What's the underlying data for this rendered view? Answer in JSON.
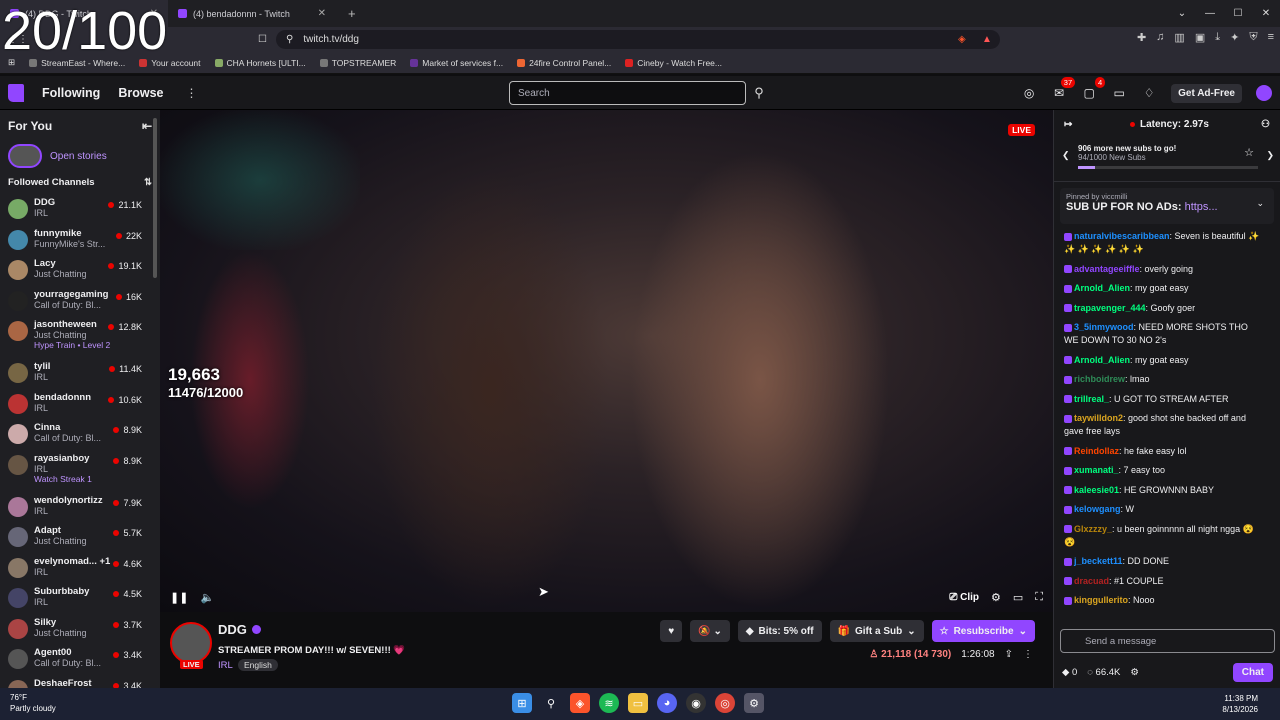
{
  "overlay_counter": "20/100",
  "browser": {
    "tabs": [
      {
        "title": "(4) DDG - Twitch"
      },
      {
        "title": "(4) bendadonnn - Twitch"
      }
    ],
    "url": "twitch.tv/ddg",
    "bookmarks": [
      "StreamEast - Where...",
      "Your account",
      "CHA Hornets [ULTI...",
      "TOPSTREAMER",
      "Market of services f...",
      "24fire Control Panel...",
      "Cineby - Watch Free..."
    ]
  },
  "nav": {
    "following": "Following",
    "browse": "Browse",
    "search_placeholder": "Search",
    "notif_count": "37",
    "inbox_count": "4",
    "ad_free": "Get Ad-Free"
  },
  "sidebar": {
    "for_you": "For You",
    "open_stories": "Open stories",
    "followed": "Followed Channels",
    "channels": [
      {
        "name": "DDG",
        "category": "IRL",
        "viewers": "21.1K"
      },
      {
        "name": "funnymike",
        "category": "FunnyMike's Str...",
        "viewers": "22K"
      },
      {
        "name": "Lacy",
        "category": "Just Chatting",
        "viewers": "19.1K"
      },
      {
        "name": "yourragegaming",
        "category": "Call of Duty: Bl...",
        "viewers": "16K"
      },
      {
        "name": "jasontheween",
        "category": "Just Chatting",
        "viewers": "12.8K",
        "extra": "Hype Train • Level 2"
      },
      {
        "name": "tylil",
        "category": "IRL",
        "viewers": "11.4K"
      },
      {
        "name": "bendadonnn",
        "category": "IRL",
        "viewers": "10.6K"
      },
      {
        "name": "Cinna",
        "category": "Call of Duty: Bl...",
        "viewers": "8.9K"
      },
      {
        "name": "rayasianboy",
        "category": "IRL",
        "viewers": "8.9K",
        "extra": "Watch Streak 1"
      },
      {
        "name": "wendolynortizz",
        "category": "IRL",
        "viewers": "7.9K"
      },
      {
        "name": "Adapt",
        "category": "Just Chatting",
        "viewers": "5.7K"
      },
      {
        "name": "evelynomad... +1",
        "category": "IRL",
        "viewers": "4.6K"
      },
      {
        "name": "Suburbbaby",
        "category": "IRL",
        "viewers": "4.5K"
      },
      {
        "name": "Silky",
        "category": "Just Chatting",
        "viewers": "3.7K"
      },
      {
        "name": "Agent00",
        "category": "Call of Duty: Bl...",
        "viewers": "3.4K"
      },
      {
        "name": "DeshaeFrost",
        "category": "",
        "viewers": "3.4K"
      }
    ]
  },
  "video": {
    "live": "LIVE",
    "goal_count": "19,663",
    "goal_progress": "11476/12000",
    "clip": "Clip"
  },
  "stream": {
    "channel": "DDG",
    "title": "STREAMER PROM DAY!!! w/ SEVEN!!! 💗",
    "category": "IRL",
    "language": "English",
    "bits": "Bits: 5% off",
    "gift": "Gift a Sub",
    "subscribe": "Resubscribe",
    "viewers": "21,118 (14 730)",
    "uptime": "1:26:08"
  },
  "chat": {
    "latency": "Latency: 2.97s",
    "subgoal_title": "906 more new subs to go!",
    "subgoal_sub": "94/1000 New Subs",
    "subgoal_progress": 0.094,
    "pinned_by": "Pinned by viccmilli",
    "pinned_msg": "SUB UP FOR NO ADs:",
    "pinned_link": "https...",
    "messages": [
      {
        "user": "naturalvibescaribbean",
        "color": "#1e90ff",
        "text": ": Seven is beautiful ✨ ✨ ✨ ✨ ✨ ✨ ✨"
      },
      {
        "user": "advantageeiffle",
        "color": "#9146ff",
        "text": ": overly going"
      },
      {
        "user": "Arnold_Alien",
        "color": "#00ff7f",
        "text": ": my goat easy"
      },
      {
        "user": "trapavenger_444",
        "color": "#00ff7f",
        "text": ": Goofy goer"
      },
      {
        "user": "3_5inmywood",
        "color": "#1e90ff",
        "text": ": NEED MORE SHOTS THO WE DOWN TO 30 NO 2's"
      },
      {
        "user": "Arnold_Alien",
        "color": "#00ff7f",
        "text": ": my goat easy"
      },
      {
        "user": "richboidrew",
        "color": "#2e8b57",
        "text": ": lmao"
      },
      {
        "user": "trillreal_",
        "color": "#00ff7f",
        "text": ": U GOT TO STREAM AFTER"
      },
      {
        "user": "taywilldon2",
        "color": "#daa520",
        "text": ": good shot she backed off and gave free lays"
      },
      {
        "user": "Reindollaz",
        "color": "#ff4500",
        "text": ": he fake easy lol"
      },
      {
        "user": "xumanati_",
        "color": "#00ff7f",
        "text": ": 7 easy too"
      },
      {
        "user": "kaleesie01",
        "color": "#00ff7f",
        "text": ": HE GROWNNN BABY"
      },
      {
        "user": "kelowgang",
        "color": "#1e90ff",
        "text": ": W"
      },
      {
        "user": "Glxzzzy_",
        "color": "#b8860b",
        "text": ": u been goinnnnn all night ngga 😵 😵"
      },
      {
        "user": "j_beckett11",
        "color": "#1e90ff",
        "text": ": DD DONE"
      },
      {
        "user": "dracuad",
        "color": "#b22222",
        "text": ": #1 COUPLE"
      },
      {
        "user": "kinggullerito",
        "color": "#daa520",
        "text": ": Nooo"
      }
    ],
    "input_placeholder": "Send a message",
    "bits": "0",
    "points": "66.4K",
    "chat_button": "Chat"
  },
  "taskbar": {
    "temp": "76°F",
    "weather": "Partly cloudy",
    "time": "11:38 PM",
    "date": "8/13/2026"
  }
}
